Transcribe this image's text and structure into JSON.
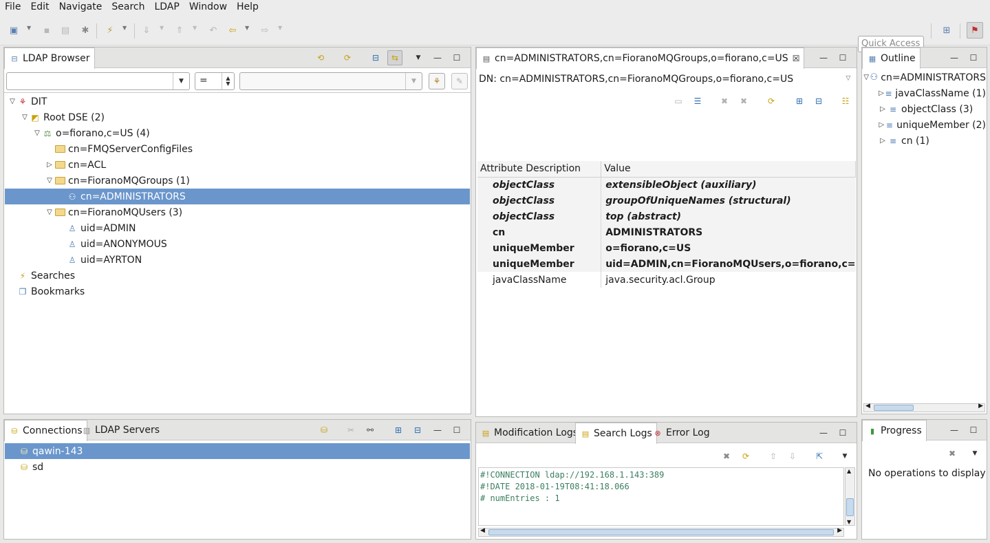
{
  "menu": [
    "File",
    "Edit",
    "Navigate",
    "Search",
    "LDAP",
    "Window",
    "Help"
  ],
  "quick_access": {
    "placeholder": "Quick Access"
  },
  "ldap_browser": {
    "tab": "LDAP Browser",
    "filter_operator": "=",
    "tree": [
      {
        "label": "DIT",
        "depth": 0,
        "twisty": "open",
        "icon": "dit-icon"
      },
      {
        "label": "Root DSE (2)",
        "depth": 1,
        "twisty": "open",
        "icon": "root-dse-icon"
      },
      {
        "label": "o=fiorano,c=US (4)",
        "depth": 2,
        "twisty": "open",
        "icon": "base-entry-icon"
      },
      {
        "label": "cn=FMQServerConfigFiles",
        "depth": 3,
        "twisty": "none",
        "icon": "folder-icon"
      },
      {
        "label": "cn=ACL",
        "depth": 3,
        "twisty": "closed",
        "icon": "folder-icon"
      },
      {
        "label": "cn=FioranoMQGroups (1)",
        "depth": 3,
        "twisty": "open",
        "icon": "folder-icon"
      },
      {
        "label": "cn=ADMINISTRATORS",
        "depth": 4,
        "twisty": "none",
        "icon": "group-icon",
        "selected": true
      },
      {
        "label": "cn=FioranoMQUsers (3)",
        "depth": 3,
        "twisty": "open",
        "icon": "folder-icon"
      },
      {
        "label": "uid=ADMIN",
        "depth": 4,
        "twisty": "none",
        "icon": "person-icon"
      },
      {
        "label": "uid=ANONYMOUS",
        "depth": 4,
        "twisty": "none",
        "icon": "person-icon"
      },
      {
        "label": "uid=AYRTON",
        "depth": 4,
        "twisty": "none",
        "icon": "person-icon"
      },
      {
        "label": "Searches",
        "depth": 0,
        "twisty": "none",
        "icon": "searches-icon"
      },
      {
        "label": "Bookmarks",
        "depth": 0,
        "twisty": "none",
        "icon": "bookmarks-icon"
      }
    ]
  },
  "editor": {
    "tab": "cn=ADMINISTRATORS,cn=FioranoMQGroups,o=fiorano,c=US",
    "dn": "DN: cn=ADMINISTRATORS,cn=FioranoMQGroups,o=fiorano,c=US",
    "columns": [
      "Attribute Description",
      "Value"
    ],
    "rows": [
      {
        "attr": "objectClass",
        "value": "extensibleObject (auxiliary)",
        "style": "bi"
      },
      {
        "attr": "objectClass",
        "value": "groupOfUniqueNames (structural)",
        "style": "bi"
      },
      {
        "attr": "objectClass",
        "value": "top (abstract)",
        "style": "bi"
      },
      {
        "attr": "cn",
        "value": "ADMINISTRATORS",
        "style": "b"
      },
      {
        "attr": "uniqueMember",
        "value": "o=fiorano,c=US",
        "style": "b"
      },
      {
        "attr": "uniqueMember",
        "value": "uid=ADMIN,cn=FioranoMQUsers,o=fiorano,c=",
        "style": "b"
      },
      {
        "attr": "javaClassName",
        "value": "java.security.acl.Group",
        "style": ""
      }
    ]
  },
  "outline": {
    "tab": "Outline",
    "root": "cn=ADMINISTRATORS",
    "items": [
      "javaClassName (1)",
      "objectClass (3)",
      "uniqueMember (2)",
      "cn (1)"
    ]
  },
  "connections": {
    "tabs": [
      "Connections",
      "LDAP Servers"
    ],
    "items": [
      "qawin-143",
      "sd"
    ]
  },
  "logs": {
    "tabs": [
      "Modification Logs",
      "Search Logs",
      "Error Log"
    ],
    "lines": [
      "#!CONNECTION ldap://192.168.1.143:389",
      "#!DATE 2018-01-19T08:41:18.066",
      "# numEntries : 1"
    ]
  },
  "progress": {
    "tab": "Progress",
    "message": "No operations to display at"
  }
}
